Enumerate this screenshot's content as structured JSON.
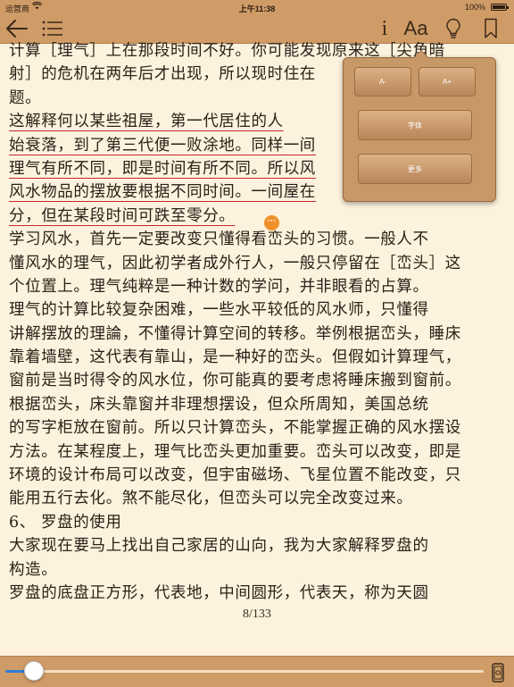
{
  "status_bar": {
    "carrier": "运营商",
    "time": "上午11:38",
    "battery": "100%"
  },
  "toolbar": {
    "back": "back-arrow-icon",
    "list": "list-icon",
    "info_label": "i",
    "font_label": "Aa",
    "bulb": "lightbulb-icon",
    "bookmark": "bookmark-icon"
  },
  "reading": {
    "lines": [
      "计算［理气］上在那段时间不好。你可能发现原来这［尖角暗",
      "射］的危机在两年后才出现，所以现时住在",
      "题。",
      "    这解释何以某些祖屋，第一代居住的人",
      "始衰落，到了第三代便一败涂地。同样一间",
      "理气有所不同，即是时间有所不同。所以风",
      "风水物品的摆放要根据不同时间。一间屋在",
      "分，但在某段时间可跌至零分。",
      "    学习风水，首先一定要改变只懂得看峦头的习惯。一般人不",
      "懂风水的理气，因此初学者成外行人，一般只停留在［峦头］这",
      "个位置上。理气纯粹是一种计数的学问，并非眼看的占算。",
      "    理气的计算比较复杂困难，一些水平较低的风水师，只懂得",
      "讲解摆放的理論，不懂得计算空间的转移。举例根据峦头，睡床",
      "靠着墙壁，这代表有靠山，是一种好的峦头。但假如计算理气，",
      "窗前是当时得令的风水位，你可能真的要考虑将睡床搬到窗前。",
      "    根据峦头，床头靠窗并非理想摆设，但众所周知，美国总统",
      "的写字柜放在窗前。所以只计算峦头，不能掌握正确的风水摆设",
      "方法。在某程度上，理气比峦头更加重要。峦头可以改变，即是",
      "环境的设计布局可以改变，但宇宙磁场、飞星位置不能改变，只",
      "能用五行去化。煞不能尽化，但峦头可以完全改变过来。",
      "    6、 罗盘的使用",
      "    大家现在要马上找出自己家居的山向，我为大家解释罗盘的",
      "构造。",
      "    罗盘的底盘正方形，代表地，中间圆形，代表天，称为天圆"
    ],
    "note_marker": "···",
    "page_indicator": "8/133"
  },
  "font_popover": {
    "decrease": "A-",
    "increase": "A+",
    "font": "字体",
    "more": "更多"
  },
  "bottom_bar": {
    "progress": 0.06,
    "rotate": "rotation-lock-icon"
  },
  "colors": {
    "bar": "#cf9b66",
    "page": "#fcf2dd",
    "underline": "#c32a2a",
    "slider_fill": "#2f7bd6"
  }
}
